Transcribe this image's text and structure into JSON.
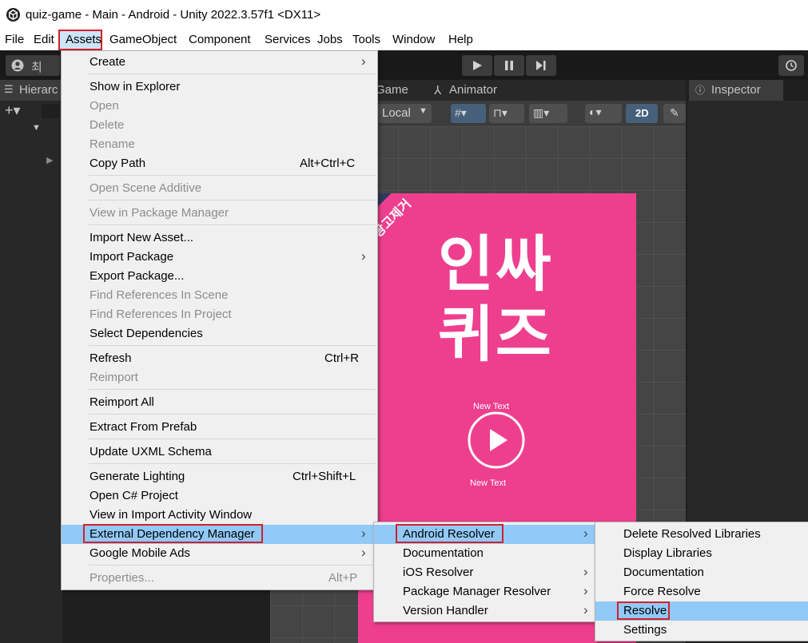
{
  "title_bar": {
    "title": "quiz-game - Main - Android - Unity 2022.3.57f1 <DX11>"
  },
  "menu_bar": [
    "File",
    "Edit",
    "Assets",
    "GameObject",
    "Component",
    "Services",
    "Jobs",
    "Tools",
    "Window",
    "Help"
  ],
  "toolbar": {
    "account_label": "최"
  },
  "panels": {
    "hierarchy_tab": "Hierarc",
    "game_tab": "Game",
    "animator_tab": "Animator",
    "inspector_tab": "Inspector",
    "local_label": "Local",
    "mode_2d": "2D"
  },
  "game_canvas": {
    "banner": "광고제거",
    "title_line1": "인싸",
    "title_line2": "퀴즈",
    "text_top": "New Text",
    "text_bottom": "New Text"
  },
  "assets_menu": {
    "create": "Create",
    "show_in_explorer": "Show in Explorer",
    "open": "Open",
    "delete": "Delete",
    "rename": "Rename",
    "copy_path": "Copy Path",
    "copy_path_sc": "Alt+Ctrl+C",
    "open_scene_additive": "Open Scene Additive",
    "view_in_package_manager": "View in Package Manager",
    "import_new_asset": "Import New Asset...",
    "import_package": "Import Package",
    "export_package": "Export Package...",
    "find_refs_scene": "Find References In Scene",
    "find_refs_project": "Find References In Project",
    "select_dependencies": "Select Dependencies",
    "refresh": "Refresh",
    "refresh_sc": "Ctrl+R",
    "reimport": "Reimport",
    "reimport_all": "Reimport All",
    "extract_from_prefab": "Extract From Prefab",
    "update_uxml": "Update UXML Schema",
    "generate_lighting": "Generate Lighting",
    "generate_lighting_sc": "Ctrl+Shift+L",
    "open_csharp": "Open C# Project",
    "view_import_activity": "View in Import Activity Window",
    "edm": "External Dependency Manager",
    "google_mobile_ads": "Google Mobile Ads",
    "properties": "Properties...",
    "properties_sc": "Alt+P"
  },
  "edm_menu": {
    "android_resolver": "Android Resolver",
    "documentation": "Documentation",
    "ios_resolver": "iOS Resolver",
    "package_manager_resolver": "Package Manager Resolver",
    "version_handler": "Version Handler"
  },
  "android_menu": {
    "delete_resolved": "Delete Resolved Libraries",
    "display_libraries": "Display Libraries",
    "documentation": "Documentation",
    "force_resolve": "Force Resolve",
    "resolve": "Resolve",
    "settings": "Settings"
  },
  "colors": {
    "highlight": "#91c9f7",
    "annotation_red": "#d5202a",
    "canvas_pink": "#ee3f8f"
  }
}
